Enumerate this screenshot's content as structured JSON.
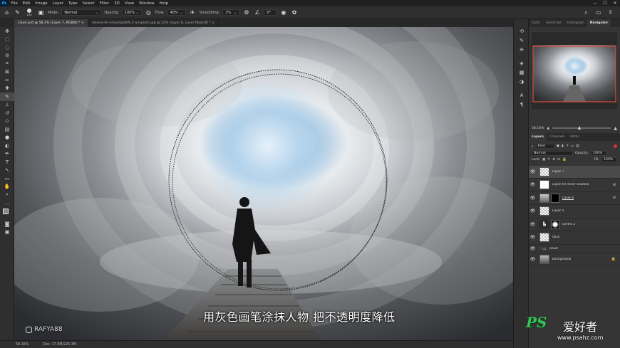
{
  "menubar": {
    "logo": "Ps",
    "items": [
      "File",
      "Edit",
      "Image",
      "Layer",
      "Type",
      "Select",
      "Filter",
      "3D",
      "View",
      "Window",
      "Help"
    ],
    "window_controls": [
      "—",
      "☐",
      "✕"
    ]
  },
  "options": {
    "brush_size": "100",
    "mode_label": "Mode:",
    "mode_value": "Normal",
    "opacity_label": "Opacity:",
    "opacity_value": "100%",
    "flow_label": "Flow:",
    "flow_value": "40%",
    "smoothing_label": "Smoothing:",
    "smoothing_value": "3%",
    "angle_value": "0°"
  },
  "tabs": [
    {
      "label": "cloud.psd @ 58.2% (Layer 7, RGB/8) *  ×",
      "active": true
    },
    {
      "label": "alessio-lin-ndvoetyVbW_F-unsplash.jpg @ 22% (Layer 8, Layer Mask/8) *  ×",
      "active": false
    }
  ],
  "canvas": {
    "subtitle": "用灰色画笔涂抹人物 把不透明度降低",
    "instagram": "RAFYA88"
  },
  "watermark": {
    "ps": "PS",
    "cn": "爱好者",
    "url": "www.psahz.com"
  },
  "status": {
    "zoom": "58.16%",
    "doc": "Doc: 17.9M/225.3M"
  },
  "navigator": {
    "tabs": [
      "Color",
      "Swatches",
      "Histogram",
      "Navigator"
    ],
    "active": "Navigator",
    "zoom": "58.16%"
  },
  "layers_panel": {
    "tabs": [
      "Layers",
      "Channels",
      "Paths"
    ],
    "active": "Layers",
    "kind_label": "Kind",
    "blend_mode": "Normal",
    "opacity_label": "Opacity:",
    "opacity_value": "100%",
    "lock_label": "Lock:",
    "fill_label": "Fill:",
    "fill_value": "100%",
    "layers": [
      {
        "name": "Layer 7",
        "selected": true,
        "thumb": "checker",
        "fx": ""
      },
      {
        "name": "Layer 6's Inner Shadow",
        "selected": false,
        "thumb": "white",
        "fx": "⊞"
      },
      {
        "name": "Layer 6",
        "selected": false,
        "thumb": "photo",
        "fx": "⊞"
      },
      {
        "name": "Layer 5",
        "selected": false,
        "thumb": "checker",
        "fx": ""
      },
      {
        "name": "Levels 2",
        "selected": false,
        "thumb": "levels",
        "fx": ""
      },
      {
        "name": "dock",
        "selected": false,
        "thumb": "checker",
        "fx": ""
      },
      {
        "name": "cloud",
        "selected": false,
        "thumb": "folder",
        "fx": ""
      },
      {
        "name": "Background",
        "selected": false,
        "thumb": "photo",
        "fx": "🔒"
      }
    ]
  },
  "colors": {
    "accent_nav_box": "#e04a3a",
    "watermark_green": "#35c35a",
    "selected_layer": "#4a4a4a"
  }
}
